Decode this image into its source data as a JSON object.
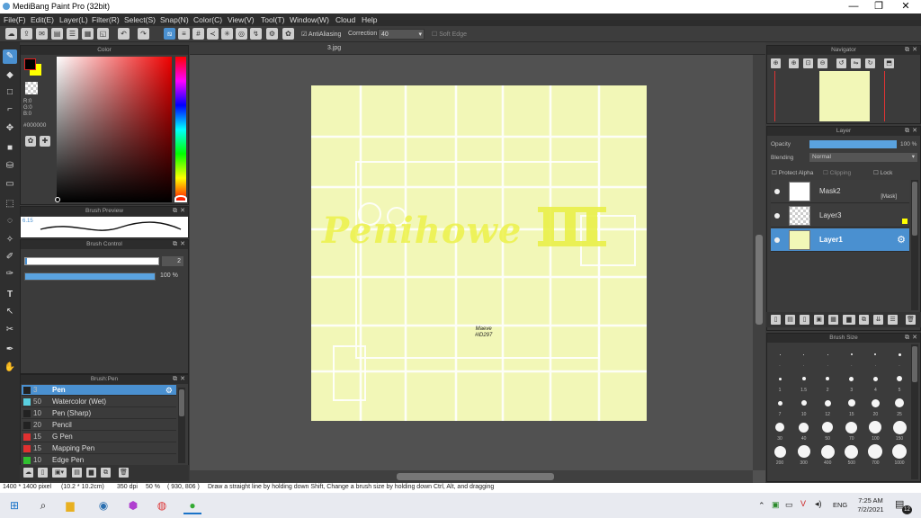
{
  "window": {
    "title": "MediBang Paint Pro (32bit)",
    "minimize": "—",
    "maximize": "❐",
    "close": "✕"
  },
  "menu": [
    "File(F)",
    "Edit(E)",
    "Layer(L)",
    "Filter(R)",
    "Select(S)",
    "Snap(N)",
    "Color(C)",
    "View(V)",
    "Tool(T)",
    "Window(W)",
    "Cloud",
    "Help"
  ],
  "toolbar": {
    "antialias_label": "AntiAliasing",
    "correction_label": "Correction",
    "correction_value": "40",
    "soft_edge_label": "Soft Edge"
  },
  "color_panel": {
    "title": "Color",
    "rgb_r": "R:0",
    "rgb_g": "G:0",
    "rgb_b": "B:0",
    "hex": "#000000",
    "fg_color": "#000000",
    "bg_color": "#ffff00"
  },
  "brush_preview": {
    "title": "Brush Preview",
    "size": "6.15"
  },
  "brush_control": {
    "title": "Brush Control",
    "size_value": "2",
    "opacity_value": "100 %",
    "opacity_fraction": 1.0
  },
  "brush_panel": {
    "title": "Brush:Pen",
    "brushes": [
      {
        "size": "3",
        "name": "Pen",
        "color": "#222222",
        "selected": true
      },
      {
        "size": "50",
        "name": "Watercolor (Wet)",
        "color": "#5ad0e0",
        "selected": false
      },
      {
        "size": "10",
        "name": "Pen (Sharp)",
        "color": "#222222",
        "selected": false
      },
      {
        "size": "20",
        "name": "Pencil",
        "color": "#222222",
        "selected": false
      },
      {
        "size": "15",
        "name": "G Pen",
        "color": "#e03030",
        "selected": false
      },
      {
        "size": "15",
        "name": "Mapping Pen",
        "color": "#e03030",
        "selected": false
      },
      {
        "size": "10",
        "name": "Edge Pen",
        "color": "#30c030",
        "selected": false
      }
    ]
  },
  "document": {
    "tab_name": "3.jpg",
    "paper_color": "#f2f7b7",
    "artwork_text": "Penihowe",
    "signature_line1": "Maeve",
    "signature_line2": "#ID297"
  },
  "navigator": {
    "title": "Navigator"
  },
  "layer_panel": {
    "title": "Layer",
    "opacity_label": "Opacity",
    "opacity_value": "100 %",
    "opacity_fraction": 1.0,
    "blending_label": "Blending",
    "blending_value": "Normal",
    "protect_alpha": "Protect Alpha",
    "clipping": "Clipping",
    "lock": "Lock",
    "layers": [
      {
        "name": "Mask2",
        "tag": "[Mask]",
        "selected": false
      },
      {
        "name": "Layer3",
        "tag": "",
        "selected": false
      },
      {
        "name": "Layer1",
        "tag": "",
        "selected": true
      }
    ]
  },
  "brush_size_panel": {
    "title": "Brush Size",
    "sizes": [
      "·",
      "·",
      "·",
      "·",
      "·",
      "·",
      "1",
      "1.5",
      "2",
      "3",
      "4",
      "5",
      "7",
      "10",
      "12",
      "15",
      "20",
      "25",
      "30",
      "40",
      "50",
      "70",
      "100",
      "150",
      "200",
      "300",
      "400",
      "500",
      "700",
      "1000"
    ]
  },
  "status": {
    "pixels": "1400 * 1400 pixel",
    "size": "(10.2 * 10.2cm)",
    "dpi": "350 dpi",
    "zoom": "50 %",
    "coords": "( 930, 806 )",
    "hint": "Draw a straight line by holding down Shift, Change a brush size by holding down Ctrl, Alt, and dragging"
  },
  "taskbar": {
    "lang": "ENG",
    "time": "7:25 AM",
    "date": "7/2/2021",
    "notif_count": "12"
  }
}
